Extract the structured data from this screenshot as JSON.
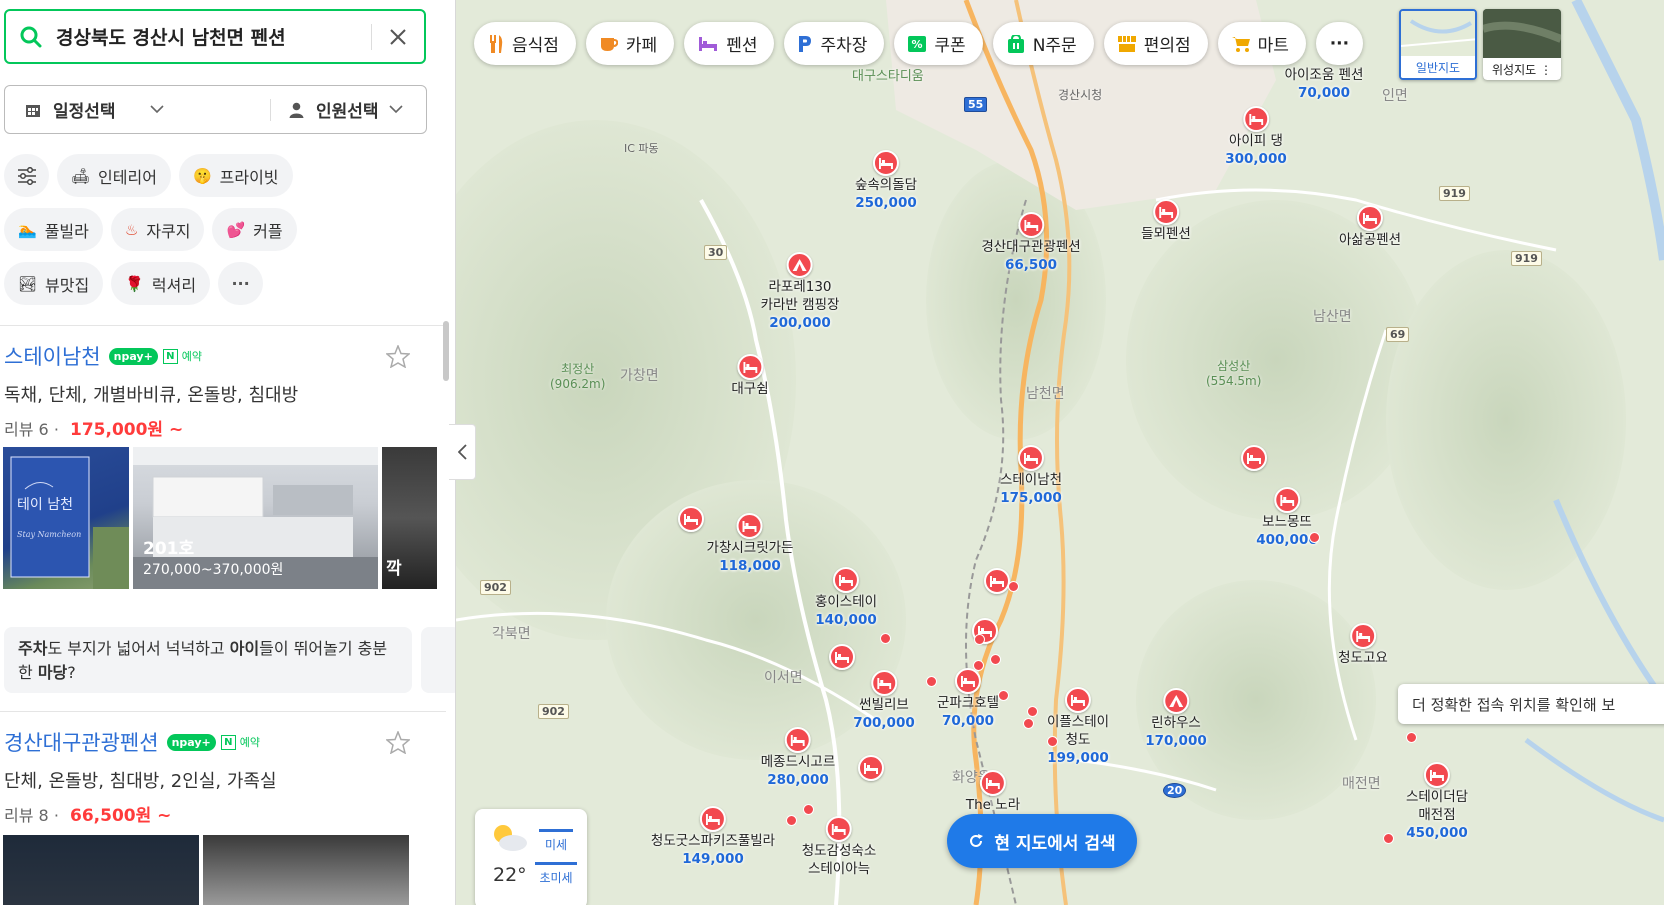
{
  "search": {
    "query": "경상북도 경산시 남천면 펜션"
  },
  "filters": {
    "schedule": "일정선택",
    "people": "인원선택"
  },
  "chips": [
    {
      "label": "인테리어",
      "emoji": "🛋"
    },
    {
      "label": "프라이빗",
      "emoji": "🤫"
    },
    {
      "label": "풀빌라",
      "emoji": "🏊"
    },
    {
      "label": "자쿠지",
      "emoji": "♨"
    },
    {
      "label": "커플",
      "emoji": "💕"
    },
    {
      "label": "뷰맛집",
      "emoji": "🏞"
    },
    {
      "label": "럭셔리",
      "emoji": "🌹"
    },
    {
      "label": "···"
    }
  ],
  "places": [
    {
      "name": "스테이남천",
      "npay": "npay+",
      "n_badge": "N",
      "reservation": "예약",
      "tags": "독채, 단체, 개별바비큐, 온돌방, 침대방",
      "review": "리뷰 6",
      "sep": "·",
      "price": "175,000원 ~",
      "photos": [
        {
          "caption": "",
          "sub": ""
        },
        {
          "caption": "201호",
          "sub": "270,000~370,000원"
        },
        {
          "caption": "깍",
          "sub": ""
        }
      ],
      "review_parts": [
        "주차",
        "도 부지가 넓어서 넉넉하고 ",
        "아이",
        "들이 뛰어놀기 충분한 ",
        "마당",
        "?"
      ]
    },
    {
      "name": "경산대구관광펜션",
      "npay": "npay+",
      "n_badge": "N",
      "reservation": "예약",
      "tags": "단체, 온돌방, 침대방, 2인실, 가족실",
      "review": "리뷰 8",
      "sep": "·",
      "price": "66,500원 ~"
    }
  ],
  "map": {
    "categories": [
      {
        "label": "음식점",
        "icon": "fork-knife-icon",
        "color": "#f08a24"
      },
      {
        "label": "카페",
        "icon": "coffee-cup-icon",
        "color": "#f08a24"
      },
      {
        "label": "펜션",
        "icon": "bed-icon",
        "color": "#a05bd8"
      },
      {
        "label": "주차장",
        "icon": "parking-icon",
        "color": "#2e6fd5"
      },
      {
        "label": "쿠폰",
        "icon": "coupon-icon",
        "color": "#03c75a"
      },
      {
        "label": "N주문",
        "icon": "order-bag-icon",
        "color": "#03c75a"
      },
      {
        "label": "편의점",
        "icon": "store-icon",
        "color": "#f0a800"
      },
      {
        "label": "마트",
        "icon": "cart-icon",
        "color": "#f0a800"
      },
      {
        "label": "···"
      }
    ],
    "map_types": {
      "normal": "일반지도",
      "satellite": "위성지도 ⋮"
    },
    "pois": [
      {
        "name": "아이조움 펜션",
        "price": "70,000"
      },
      {
        "name": "아이피 댕",
        "price": "300,000"
      },
      {
        "name": "숲속의돌담",
        "price": "250,000"
      },
      {
        "name": "경산대구관광펜션",
        "price": "66,500"
      },
      {
        "name": "들뫼펜션",
        "price": ""
      },
      {
        "name": "아삶공펜션",
        "price": ""
      },
      {
        "name": "라포레130\n카라반 캠핑장",
        "price": "200,000"
      },
      {
        "name": "대구쉼",
        "price": ""
      },
      {
        "name": "스테이남천",
        "price": "175,000"
      },
      {
        "name": "보느몽뜨",
        "price": "400,000"
      },
      {
        "name": "가창시크릿가든",
        "price": "118,000"
      },
      {
        "name": "홍이스테이",
        "price": "140,000"
      },
      {
        "name": "썬빌리브",
        "price": "700,000"
      },
      {
        "name": "군파크호텔",
        "price": "70,000"
      },
      {
        "name": "이플스테이\n청도",
        "price": "199,000"
      },
      {
        "name": "린하우스",
        "price": "170,000"
      },
      {
        "name": "청도고요",
        "price": ""
      },
      {
        "name": "메종드시고르",
        "price": "280,000"
      },
      {
        "name": "The 노라",
        "price": ""
      },
      {
        "name": "스테이더담\n매전점",
        "price": "450,000"
      },
      {
        "name": "청도굿스파키즈풀빌라",
        "price": "149,000"
      },
      {
        "name": "청도감성숙소\n스테이아늑",
        "price": ""
      }
    ],
    "labels": {
      "stadium": "대구스타디움",
      "city_hall": "경산시청",
      "ic": "IC 파동",
      "mt1": "최정산\n(906.2m)",
      "mt2": "삼성산\n(554.5m)",
      "gachang": "가창면",
      "namcheon": "남천면",
      "namsan": "남산면",
      "gakbuk": "각북면",
      "iseo": "이서면",
      "maejeon": "매전면",
      "hwayang": "화양읍",
      "inmyeon": "인면"
    },
    "shields": [
      "55",
      "30",
      "919",
      "919",
      "69",
      "902",
      "902",
      "20"
    ],
    "weather": {
      "temp": "22°",
      "mise": "미세",
      "chomise": "초미세"
    },
    "research_btn": "현 지도에서 검색",
    "tooltip": "더 정확한 접속 위치를 확인해 보"
  }
}
